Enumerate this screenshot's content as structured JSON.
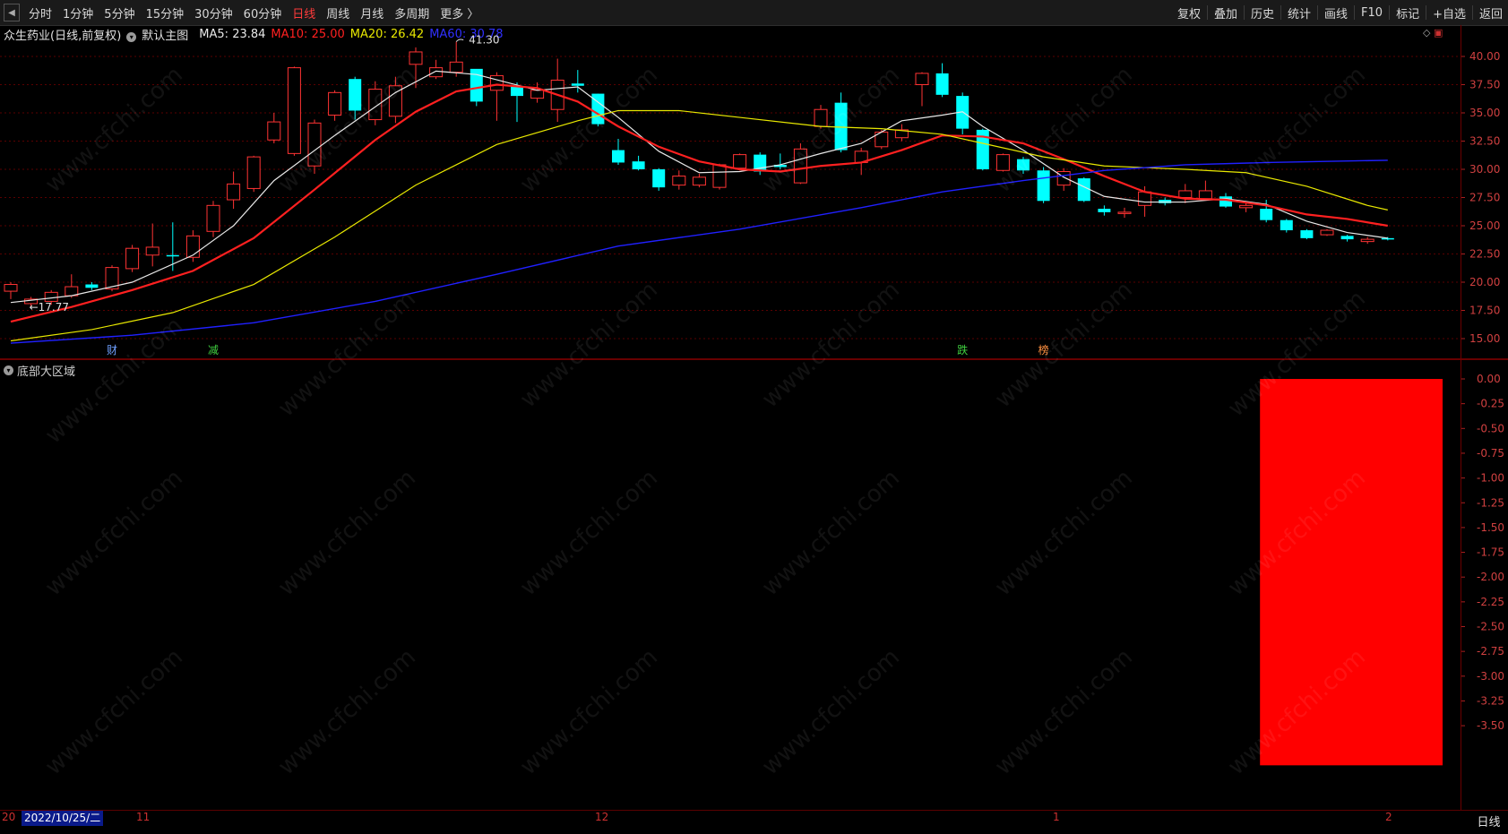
{
  "toolbar": {
    "periods": [
      "分时",
      "1分钟",
      "5分钟",
      "15分钟",
      "30分钟",
      "60分钟",
      "日线",
      "周线",
      "月线",
      "多周期",
      "更多 〉"
    ],
    "active_period": "日线",
    "right_tools": [
      "复权",
      "叠加",
      "历史",
      "统计",
      "画线",
      "F10",
      "标记",
      "+自选",
      "返回"
    ]
  },
  "legend": {
    "stock": "众生药业(日线,前复权)",
    "template": "默认主图",
    "ma5": "MA5: 23.84",
    "ma10": "MA10: 25.00",
    "ma20": "MA20: 26.42",
    "ma60": "MA60: 30.78"
  },
  "colors": {
    "up": "#ff3333",
    "down": "#00ffff",
    "ma5": "#e8e8e8",
    "ma10": "#ff2020",
    "ma20": "#e8e800",
    "ma60": "#2020ff",
    "sub_bar": "#ff0000"
  },
  "main_axis": [
    "40.00",
    "37.50",
    "35.00",
    "32.50",
    "30.00",
    "27.50",
    "25.00",
    "22.50",
    "20.00",
    "17.50",
    "15.00"
  ],
  "annotations": {
    "high": "41.30",
    "low": "17.77"
  },
  "event_markers": [
    {
      "label": "财",
      "color": "#6fa0ff"
    },
    {
      "label": "减",
      "color": "#40d040"
    },
    {
      "label": "跌",
      "color": "#40d040"
    },
    {
      "label": "榜",
      "color": "#ff9040"
    }
  ],
  "sub_panel": {
    "title": "底部大区域",
    "axis": [
      "0.00",
      "-0.25",
      "-0.50",
      "-0.75",
      "-1.00",
      "-1.25",
      "-1.50",
      "-1.75",
      "-2.00",
      "-2.25",
      "-2.50",
      "-2.75",
      "-3.00",
      "-3.25",
      "-3.50"
    ]
  },
  "bottom": {
    "date": "2022/10/25/二",
    "left_stub": "20",
    "months": [
      "11",
      "12",
      "1",
      "2"
    ],
    "period_tab": "日线"
  },
  "watermark": "www.cfchi.com",
  "chart_data": {
    "type": "candlestick",
    "y_range": [
      14.0,
      41.5
    ],
    "candles": [
      [
        19.2,
        19.8,
        18.5,
        20.0
      ],
      [
        18.1,
        18.5,
        17.8,
        18.7
      ],
      [
        18.3,
        19.1,
        18.0,
        19.3
      ],
      [
        18.8,
        19.6,
        18.6,
        20.7
      ],
      [
        19.8,
        19.5,
        19.3,
        20.0
      ],
      [
        19.4,
        21.3,
        19.2,
        21.5
      ],
      [
        21.2,
        23.0,
        20.9,
        23.3
      ],
      [
        22.4,
        23.1,
        21.4,
        25.2
      ],
      [
        22.4,
        22.3,
        21.0,
        25.3
      ],
      [
        22.2,
        24.1,
        21.8,
        24.6
      ],
      [
        24.5,
        26.8,
        24.0,
        27.2
      ],
      [
        27.3,
        28.7,
        26.5,
        29.8
      ],
      [
        28.3,
        31.1,
        28.0,
        31.2
      ],
      [
        32.6,
        34.2,
        32.3,
        35.0
      ],
      [
        31.4,
        39.0,
        31.2,
        39.1
      ],
      [
        30.3,
        34.1,
        29.6,
        34.4
      ],
      [
        34.8,
        36.8,
        34.3,
        37.0
      ],
      [
        38.0,
        35.2,
        34.4,
        38.2
      ],
      [
        34.4,
        37.1,
        33.9,
        37.8
      ],
      [
        34.7,
        37.4,
        34.1,
        38.2
      ],
      [
        39.3,
        40.4,
        37.2,
        40.8
      ],
      [
        38.2,
        39.0,
        38.0,
        39.7
      ],
      [
        38.6,
        39.5,
        38.2,
        41.3
      ],
      [
        38.9,
        36.0,
        35.6,
        38.8
      ],
      [
        37.0,
        38.3,
        34.3,
        38.6
      ],
      [
        37.3,
        36.5,
        34.2,
        37.7
      ],
      [
        36.3,
        37.0,
        35.9,
        37.7
      ],
      [
        35.3,
        37.9,
        34.2,
        39.8
      ],
      [
        37.6,
        37.4,
        36.8,
        38.8
      ],
      [
        36.7,
        34.0,
        33.8,
        36.7
      ],
      [
        31.7,
        30.6,
        30.4,
        32.7
      ],
      [
        30.7,
        30.0,
        29.9,
        31.2
      ],
      [
        30.0,
        28.4,
        28.1,
        30.1
      ],
      [
        28.6,
        29.4,
        28.2,
        29.9
      ],
      [
        28.6,
        29.3,
        28.4,
        29.6
      ],
      [
        28.4,
        30.4,
        28.2,
        30.5
      ],
      [
        30.1,
        31.3,
        29.9,
        31.4
      ],
      [
        31.3,
        29.8,
        29.5,
        31.5
      ],
      [
        30.4,
        30.2,
        30.0,
        31.4
      ],
      [
        28.8,
        31.8,
        28.7,
        32.3
      ],
      [
        33.8,
        35.3,
        33.6,
        35.7
      ],
      [
        35.9,
        31.7,
        31.5,
        36.8
      ],
      [
        30.6,
        31.6,
        29.5,
        31.9
      ],
      [
        32.0,
        33.3,
        31.8,
        33.5
      ],
      [
        32.8,
        33.5,
        32.5,
        34.0
      ],
      [
        37.5,
        38.5,
        35.6,
        38.6
      ],
      [
        38.5,
        36.6,
        36.4,
        39.4
      ],
      [
        36.5,
        33.6,
        33.1,
        36.8
      ],
      [
        33.5,
        30.0,
        29.9,
        33.6
      ],
      [
        29.9,
        31.3,
        29.8,
        31.4
      ],
      [
        30.9,
        29.9,
        29.6,
        31.1
      ],
      [
        29.9,
        27.2,
        27.0,
        30.2
      ],
      [
        28.6,
        29.8,
        28.1,
        30.1
      ],
      [
        29.2,
        27.2,
        27.1,
        29.3
      ],
      [
        26.5,
        26.2,
        25.9,
        26.8
      ],
      [
        26.2,
        26.2,
        25.7,
        26.6
      ],
      [
        26.8,
        28.0,
        25.8,
        28.5
      ],
      [
        27.3,
        27.0,
        26.8,
        27.5
      ],
      [
        27.5,
        28.1,
        27.0,
        28.7
      ],
      [
        27.4,
        28.1,
        27.4,
        29.0
      ],
      [
        27.6,
        26.7,
        26.6,
        27.9
      ],
      [
        26.6,
        26.8,
        26.2,
        27.1
      ],
      [
        26.5,
        25.5,
        25.3,
        27.3
      ],
      [
        25.5,
        24.6,
        24.4,
        25.6
      ],
      [
        24.6,
        23.9,
        23.8,
        24.7
      ],
      [
        24.2,
        24.6,
        24.1,
        24.7
      ],
      [
        24.1,
        23.8,
        23.6,
        24.2
      ],
      [
        23.6,
        23.8,
        23.4,
        24.0
      ],
      [
        23.9,
        23.8,
        23.7,
        24.0
      ]
    ],
    "ma": {
      "ma5": [
        [
          0,
          18.2
        ],
        [
          3,
          18.8
        ],
        [
          6,
          20.0
        ],
        [
          9,
          22.4
        ],
        [
          11,
          25.0
        ],
        [
          13,
          29.0
        ],
        [
          16,
          33.0
        ],
        [
          19,
          36.8
        ],
        [
          21,
          38.7
        ],
        [
          23,
          38.4
        ],
        [
          26,
          37.0
        ],
        [
          28,
          37.3
        ],
        [
          30,
          34.6
        ],
        [
          32,
          31.6
        ],
        [
          34,
          29.7
        ],
        [
          36,
          29.8
        ],
        [
          38,
          30.4
        ],
        [
          40,
          31.4
        ],
        [
          42,
          32.3
        ],
        [
          44,
          34.3
        ],
        [
          46,
          34.8
        ],
        [
          47,
          35.1
        ],
        [
          48,
          33.8
        ],
        [
          50,
          31.7
        ],
        [
          52,
          29.3
        ],
        [
          54,
          27.6
        ],
        [
          56,
          27.1
        ],
        [
          58,
          27.1
        ],
        [
          60,
          27.4
        ],
        [
          62,
          26.9
        ],
        [
          64,
          25.4
        ],
        [
          66,
          24.4
        ],
        [
          68,
          23.9
        ]
      ],
      "ma10": [
        [
          0,
          16.5
        ],
        [
          3,
          17.8
        ],
        [
          6,
          19.3
        ],
        [
          9,
          21.0
        ],
        [
          12,
          23.9
        ],
        [
          15,
          28.2
        ],
        [
          18,
          32.6
        ],
        [
          20,
          35.1
        ],
        [
          22,
          36.9
        ],
        [
          24,
          37.5
        ],
        [
          26,
          37.2
        ],
        [
          28,
          36.0
        ],
        [
          30,
          33.8
        ],
        [
          32,
          32.0
        ],
        [
          34,
          30.7
        ],
        [
          36,
          30.0
        ],
        [
          38,
          29.8
        ],
        [
          40,
          30.3
        ],
        [
          42,
          30.6
        ],
        [
          44,
          31.7
        ],
        [
          46,
          33.0
        ],
        [
          48,
          32.9
        ],
        [
          50,
          32.3
        ],
        [
          52,
          30.9
        ],
        [
          54,
          29.4
        ],
        [
          56,
          28.0
        ],
        [
          58,
          27.4
        ],
        [
          60,
          27.3
        ],
        [
          62,
          26.8
        ],
        [
          64,
          26.0
        ],
        [
          66,
          25.6
        ],
        [
          68,
          25.0
        ]
      ],
      "ma20": [
        [
          0,
          14.8
        ],
        [
          4,
          15.8
        ],
        [
          8,
          17.3
        ],
        [
          12,
          19.8
        ],
        [
          16,
          24.0
        ],
        [
          20,
          28.6
        ],
        [
          24,
          32.2
        ],
        [
          28,
          34.3
        ],
        [
          30,
          35.2
        ],
        [
          33,
          35.2
        ],
        [
          36,
          34.6
        ],
        [
          40,
          33.8
        ],
        [
          43,
          33.6
        ],
        [
          46,
          33.1
        ],
        [
          48,
          32.3
        ],
        [
          51,
          31.1
        ],
        [
          54,
          30.3
        ],
        [
          58,
          30.0
        ],
        [
          61,
          29.7
        ],
        [
          64,
          28.5
        ],
        [
          67,
          26.8
        ],
        [
          68,
          26.4
        ]
      ],
      "ma60": [
        [
          0,
          14.6
        ],
        [
          6,
          15.3
        ],
        [
          12,
          16.4
        ],
        [
          18,
          18.3
        ],
        [
          24,
          20.7
        ],
        [
          30,
          23.2
        ],
        [
          36,
          24.7
        ],
        [
          42,
          26.6
        ],
        [
          46,
          28.0
        ],
        [
          50,
          29.0
        ],
        [
          54,
          29.9
        ],
        [
          58,
          30.4
        ],
        [
          62,
          30.6
        ],
        [
          68,
          30.8
        ]
      ]
    },
    "markers": [
      {
        "x": 5,
        "label": "财"
      },
      {
        "x": 10,
        "label": "减"
      },
      {
        "x": 47,
        "label": "跌"
      },
      {
        "x": 51,
        "label": "榜"
      }
    ],
    "sub_indicator": {
      "name": "底部大区域",
      "value": -3.9,
      "from_index": 62,
      "y_range": [
        -4.0,
        0.0
      ]
    }
  }
}
